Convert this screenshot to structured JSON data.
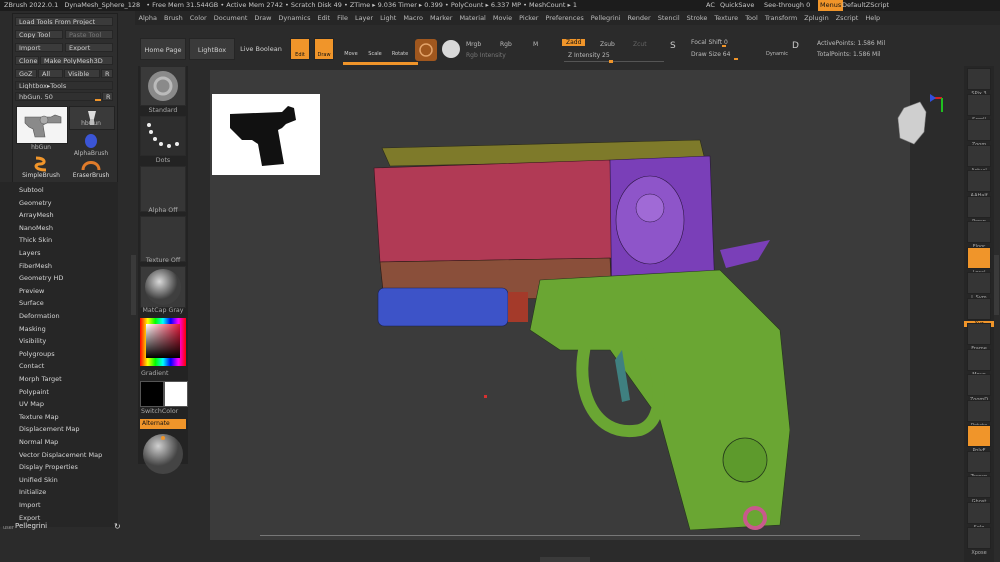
{
  "titlebar": {
    "app": "ZBrush 2022.0.1",
    "mesh": "DynaMesh_Sphere_128",
    "stats": "• Free Mem 31.544GB • Active Mem 2742 • Scratch Disk 49 • ZTime ▸ 9.036 Timer ▸ 0.399 • PolyCount ▸ 6.337 MP • MeshCount ▸ 1",
    "ac": "AC",
    "quicksave": "QuickSave",
    "seethrough": "See-through  0",
    "menus": "Menus",
    "script": "DefaultZScript"
  },
  "menubar": [
    "Alpha",
    "Brush",
    "Color",
    "Document",
    "Draw",
    "Dynamics",
    "Edit",
    "File",
    "Layer",
    "Light",
    "Macro",
    "Marker",
    "Material",
    "Movie",
    "Picker",
    "Preferences",
    "Pellegrini",
    "Render",
    "Stencil",
    "Stroke",
    "Texture",
    "Tool",
    "Transform",
    "Zplugin",
    "Zscript",
    "Help"
  ],
  "leftpanel": {
    "load_tools": "Load Tools From Project",
    "copy_tool": "Copy Tool",
    "paste_tool": "Paste Tool",
    "import": "Import",
    "export": "Export",
    "clone": "Clone",
    "make_polymesh": "Make PolyMesh3D",
    "goz": "GoZ",
    "all": "All",
    "visible": "Visible",
    "r": "R",
    "lightbox_tools": "Lightbox▸Tools",
    "slider_label": "hbGun. 50",
    "slider_r": "R",
    "hbgun1": "hbGun",
    "hbgun2": "hbGun",
    "alphabrush": "AlphaBrush",
    "simplebrush": "SimpleBrush",
    "eraserbrush": "EraserBrush"
  },
  "toolmenu": [
    "Subtool",
    "Geometry",
    "ArrayMesh",
    "NanoMesh",
    "Thick Skin",
    "Layers",
    "FiberMesh",
    "Geometry HD",
    "Preview",
    "Surface",
    "Deformation",
    "Masking",
    "Visibility",
    "Polygroups",
    "Contact",
    "Morph Target",
    "Polypaint",
    "UV Map",
    "Texture Map",
    "Displacement Map",
    "Normal Map",
    "Vector Displacement Map",
    "Display Properties",
    "Unified Skin",
    "Initialize",
    "Import",
    "Export"
  ],
  "user": {
    "label": "user",
    "name": "Pellegrini"
  },
  "shelf": {
    "standard": "Standard",
    "dots": "Dots",
    "alpha_off": "Alpha Off",
    "texture_off": "Texture Off",
    "matcap": "MatCap Gray",
    "gradient": "Gradient",
    "switchcolor": "SwitchColor",
    "alternate": "Alternate"
  },
  "toolbar": {
    "home": "Home Page",
    "lightbox": "LightBox",
    "liveboolean": "Live Boolean",
    "edit": "Edit",
    "draw": "Draw",
    "move": "Move",
    "scale": "Scale",
    "rotate": "Rotate",
    "mrgb": "Mrgb",
    "rgb": "Rgb",
    "m": "M",
    "zadd": "Zadd",
    "zsub": "Zsub",
    "zcut": "Zcut",
    "rgb_intensity": "Rgb Intensity",
    "z_intensity": "Z Intensity 25",
    "focal_shift": "Focal Shift 0",
    "draw_size": "Draw Size 64",
    "dynamic": "Dynamic",
    "active_points": "ActivePoints: 1.586 Mil",
    "total_points": "TotalPoints: 1.586 Mil"
  },
  "rightshelf": [
    "SPix 3",
    "Scroll",
    "Zoom",
    "Actual",
    "AAHalf",
    "Persp",
    "Floor",
    "Local",
    "L.Sym",
    "Xyz",
    "Frame",
    "Move",
    "ZoomD",
    "Rotate",
    "PolyF",
    "Transp",
    "Ghost",
    "Solo",
    "Xpose"
  ],
  "colors": {
    "accent": "#f0952a",
    "bg": "#2b2b2b",
    "canvas": "#3b3b3b"
  }
}
